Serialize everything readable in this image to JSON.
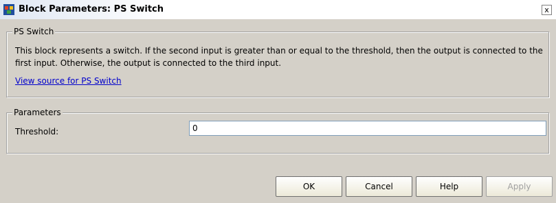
{
  "window": {
    "title": "Block Parameters: PS Switch",
    "close_label": "x"
  },
  "ps_switch_group": {
    "legend": "PS Switch",
    "description": "This block represents a switch. If the second input is greater than or equal to the threshold, then the output is connected to the first input. Otherwise, the output is connected to the third input.",
    "link_text": "View source for PS Switch"
  },
  "parameters_group": {
    "legend": "Parameters",
    "threshold_label": "Threshold:",
    "threshold_value": "0"
  },
  "buttons": {
    "ok": "OK",
    "cancel": "Cancel",
    "help": "Help",
    "apply": "Apply"
  }
}
